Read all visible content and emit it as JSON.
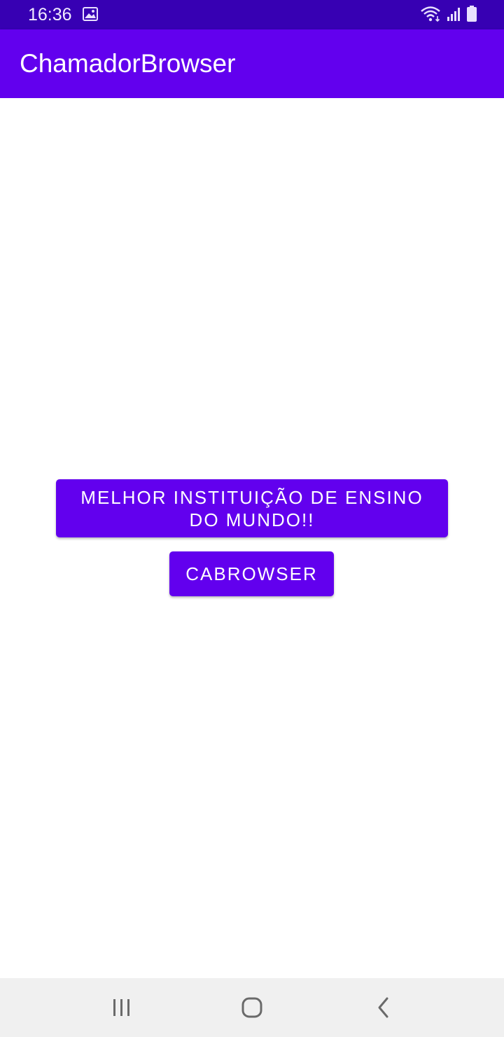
{
  "status_bar": {
    "time": "16:36",
    "icons": [
      "image-icon",
      "wifi-icon",
      "signal-icon",
      "battery-icon"
    ],
    "background": "#3700b3"
  },
  "app_bar": {
    "title": "ChamadorBrowser",
    "background": "#6200ee"
  },
  "main": {
    "button_primary_label": "MELHOR INSTITUIÇÃO DE ENSINO DO MUNDO!!",
    "button_secondary_label": "CABROWSER",
    "button_color": "#6200ee"
  },
  "nav_bar": {
    "icons": [
      "recent-apps-icon",
      "home-icon",
      "back-icon"
    ],
    "background": "#f0f0f0"
  }
}
